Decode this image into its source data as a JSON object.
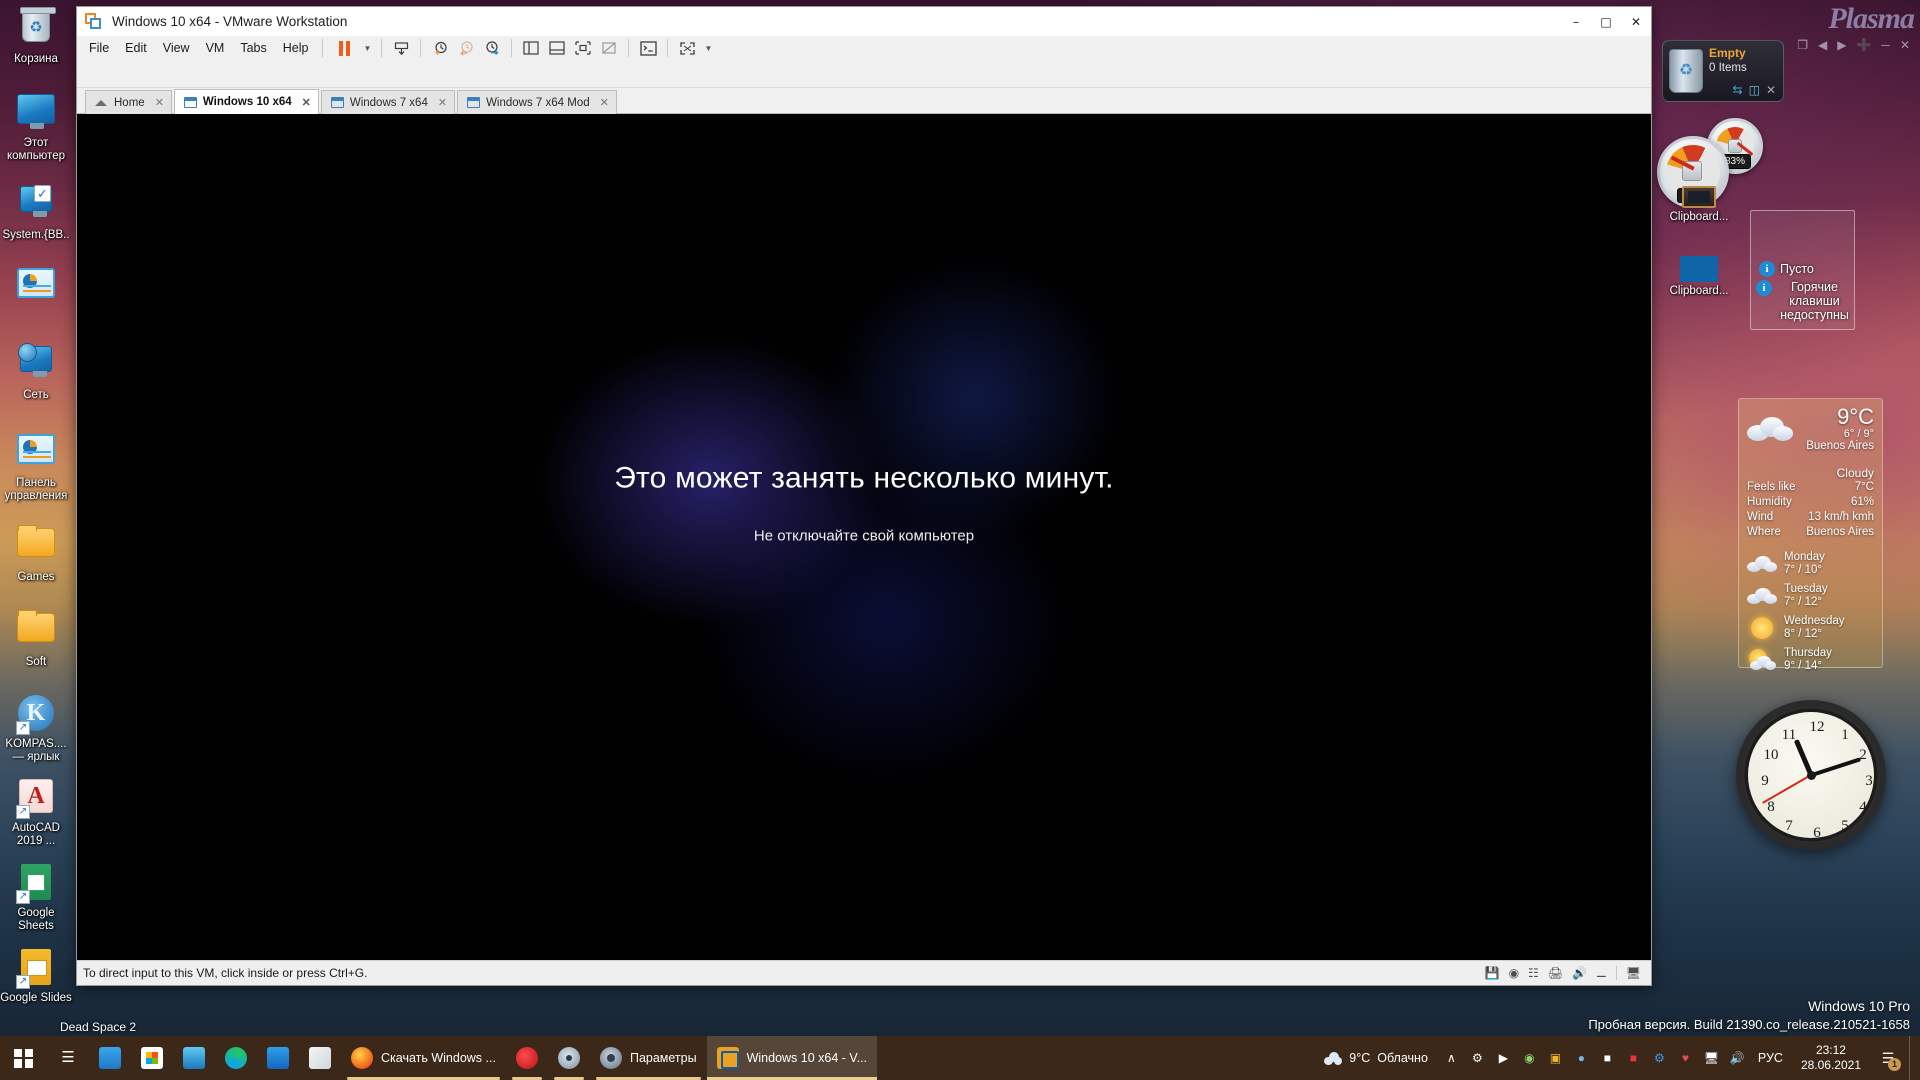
{
  "desktop": {
    "icons": [
      {
        "label": "Корзина",
        "icon": "recycle-bin-icon"
      },
      {
        "label": "Этот компьютер",
        "icon": "this-pc-icon"
      },
      {
        "label": "System.{BB..",
        "icon": "system-folder-icon"
      },
      {
        "label": "",
        "icon": "control-panel-icon"
      },
      {
        "label": "Сеть",
        "icon": "network-icon"
      },
      {
        "label": "Панель управления",
        "icon": "control-panel-icon"
      },
      {
        "label": "Games",
        "icon": "folder-icon"
      },
      {
        "label": "Soft",
        "icon": "folder-icon"
      },
      {
        "label": "KOMPAS.... — ярлык",
        "icon": "kompas-icon"
      },
      {
        "label": "AutoCAD 2019 ...",
        "icon": "autocad-icon"
      },
      {
        "label": "Google Sheets",
        "icon": "google-sheets-icon"
      },
      {
        "label": "Google Slides",
        "icon": "google-slides-icon"
      }
    ],
    "dead_space": "Dead Space 2"
  },
  "vmware": {
    "title": "Windows 10 x64 - VMware Workstation",
    "window_controls": {
      "minimize": "–",
      "maximize": "□",
      "close": "✕"
    },
    "menu": [
      "File",
      "Edit",
      "View",
      "VM",
      "Tabs",
      "Help"
    ],
    "toolbar": [
      {
        "name": "suspend-button",
        "glyph": "pause"
      },
      {
        "name": "suspend-dropdown",
        "glyph": "caret"
      },
      {
        "name": "power-button",
        "glyph": "power"
      },
      {
        "name": "snapshot-take-button",
        "glyph": "snapshot-plus"
      },
      {
        "name": "snapshot-revert-button",
        "glyph": "snapshot-back"
      },
      {
        "name": "snapshot-manager-button",
        "glyph": "snapshot-manage"
      },
      {
        "name": "show-library-button",
        "glyph": "panel-left"
      },
      {
        "name": "show-thumbnails-button",
        "glyph": "panel-bottom"
      },
      {
        "name": "show-console-button",
        "glyph": "console"
      },
      {
        "name": "hide-console-button",
        "glyph": "console-off"
      },
      {
        "name": "unity-mode-button",
        "glyph": "terminal"
      },
      {
        "name": "fullscreen-button",
        "glyph": "expand"
      },
      {
        "name": "fullscreen-dropdown",
        "glyph": "caret"
      }
    ],
    "tabs": [
      {
        "label": "Home",
        "icon": "home-icon",
        "active": false
      },
      {
        "label": "Windows 10 x64",
        "icon": "vm-icon",
        "active": true
      },
      {
        "label": "Windows 7 x64",
        "icon": "vm-icon",
        "active": false
      },
      {
        "label": "Windows 7 x64 Mod",
        "icon": "vm-icon",
        "active": false
      }
    ],
    "guest_screen": {
      "heading": "Это может занять несколько минут.",
      "subtext": "Не отключайте свой компьютер"
    },
    "status": {
      "message": "To direct input to this VM, click inside or press Ctrl+G.",
      "icons": [
        "hdd-icon",
        "cd-icon",
        "network-icon",
        "printer-icon",
        "sound-icon",
        "usb-icon",
        "display-icon"
      ]
    }
  },
  "gadgets": {
    "plasma_watermark": "Plasma",
    "recycle_bin": {
      "state": "Empty",
      "count": "0 Items",
      "actions": [
        "refresh-icon",
        "open-icon",
        "delete-icon"
      ]
    },
    "meters": {
      "cpu": "41%",
      "ram": "83%"
    },
    "clipboard_icons": [
      {
        "label": "Clipboard...",
        "icon": "clipboard-manager-icon"
      },
      {
        "label": "Clipboard...",
        "icon": "clipboard-shortcut-icon"
      }
    ],
    "clipboard_panel": {
      "empty_text": "Пусто",
      "hotkeys_text": "Горячие клавиши недоступны"
    },
    "weather": {
      "temp": "9°C",
      "hilo": "6° / 9°",
      "city": "Buenos Aires",
      "condition": "Cloudy",
      "feels_like_label": "Feels like",
      "feels_like_value": "7°C",
      "humidity_label": "Humidity",
      "humidity_value": "61%",
      "wind_label": "Wind",
      "wind_value": "13 km/h kmh",
      "where_label": "Where",
      "where_value": "Buenos Aires",
      "forecast": [
        {
          "day": "Monday",
          "temps": "7° / 10°",
          "icon": "cloudy-icon"
        },
        {
          "day": "Tuesday",
          "temps": "7° / 12°",
          "icon": "cloudy-icon"
        },
        {
          "day": "Wednesday",
          "temps": "8° / 12°",
          "icon": "sunny-icon"
        },
        {
          "day": "Thursday",
          "temps": "9° / 14°",
          "icon": "partly-cloudy-icon"
        }
      ]
    },
    "clock": {
      "hour": 11,
      "minute": 12,
      "second": 40,
      "numerals": [
        "12",
        "1",
        "2",
        "3",
        "4",
        "5",
        "6",
        "7",
        "8",
        "9",
        "10",
        "11"
      ]
    }
  },
  "watermark": {
    "line1": "Windows 10 Pro",
    "line2": "Пробная версия. Build 21390.co_release.210521-1658"
  },
  "taskbar": {
    "start": "start-button",
    "items": [
      {
        "name": "task-view-button",
        "icon": "task-view-icon",
        "label": ""
      },
      {
        "name": "taskbar-mail-blue",
        "icon": "mail-blue-icon",
        "label": ""
      },
      {
        "name": "taskbar-store",
        "icon": "microsoft-store-icon",
        "label": ""
      },
      {
        "name": "taskbar-this-pc",
        "icon": "this-pc-icon",
        "label": ""
      },
      {
        "name": "taskbar-edge",
        "icon": "edge-icon",
        "label": ""
      },
      {
        "name": "taskbar-mail",
        "icon": "mail-icon",
        "label": ""
      },
      {
        "name": "taskbar-paint",
        "icon": "paint-icon",
        "label": ""
      },
      {
        "name": "taskbar-firefox",
        "icon": "firefox-icon",
        "label": "Скачать Windows ..."
      },
      {
        "name": "taskbar-opera",
        "icon": "opera-icon",
        "label": ""
      },
      {
        "name": "taskbar-disc",
        "icon": "disc-icon",
        "label": ""
      },
      {
        "name": "taskbar-settings",
        "icon": "gear-icon",
        "label": "Параметры"
      },
      {
        "name": "taskbar-vmware",
        "icon": "vmware-icon",
        "label": "Windows 10 x64 - V..."
      }
    ],
    "tray": {
      "weather_temp": "9°C",
      "weather_cond": "Облачно",
      "chevron": "∧",
      "icons": [
        "safely-remove-icon",
        "screen-capture-icon",
        "media-player-icon",
        "update-icon",
        "qbittorrent-icon",
        "battery-icon",
        "adobe-icon",
        "bluetooth-icon",
        "security-icon",
        "network-icon",
        "volume-icon"
      ],
      "language": "РУС",
      "time": "23:12",
      "date": "28.06.2021",
      "notification_count": "1"
    }
  }
}
